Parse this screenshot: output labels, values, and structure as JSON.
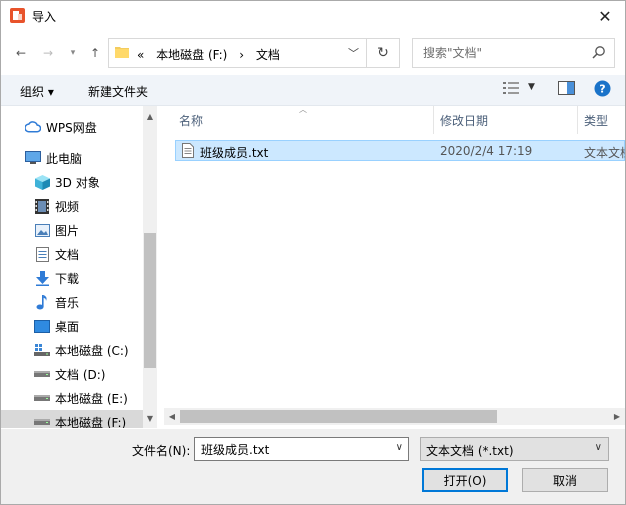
{
  "window": {
    "title": "导入"
  },
  "address": {
    "crumbs": [
      "«",
      "本地磁盘 (F:)",
      "›",
      "文档"
    ]
  },
  "search": {
    "placeholder": "搜索\"文档\""
  },
  "toolbar": {
    "organize": "组织 ▾",
    "new_folder": "新建文件夹"
  },
  "nav": {
    "items": [
      {
        "label": "WPS网盘",
        "icon": "cloud-icon"
      },
      {
        "label": "此电脑",
        "icon": "computer-icon"
      },
      {
        "label": "3D 对象",
        "icon": "cube-icon"
      },
      {
        "label": "视频",
        "icon": "video-icon"
      },
      {
        "label": "图片",
        "icon": "picture-icon"
      },
      {
        "label": "文档",
        "icon": "document-icon"
      },
      {
        "label": "下载",
        "icon": "download-icon"
      },
      {
        "label": "音乐",
        "icon": "music-icon"
      },
      {
        "label": "桌面",
        "icon": "desktop-icon"
      },
      {
        "label": "本地磁盘 (C:)",
        "icon": "drive-icon"
      },
      {
        "label": "文档 (D:)",
        "icon": "drive-icon"
      },
      {
        "label": "本地磁盘 (E:)",
        "icon": "drive-icon"
      },
      {
        "label": "本地磁盘 (F:)",
        "icon": "drive-icon"
      }
    ]
  },
  "list": {
    "columns": [
      "名称",
      "修改日期",
      "类型"
    ],
    "rows": [
      {
        "name": "班级成员.txt",
        "date": "2020/2/4 17:19",
        "type": "文本文档"
      }
    ]
  },
  "bottom": {
    "filename_label": "文件名(N):",
    "filename_value": "班级成员.txt",
    "filetype": "文本文档 (*.txt)",
    "open_button": "打开(O)",
    "cancel_button": "取消"
  },
  "colors": {
    "selection": "#cce8ff",
    "accent": "#0078d7",
    "help": "#1a73c9"
  }
}
